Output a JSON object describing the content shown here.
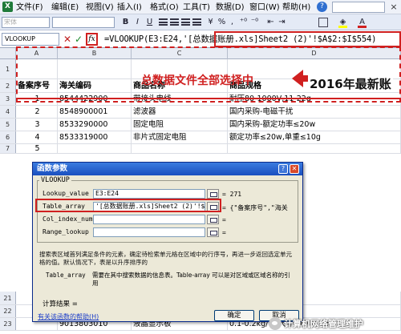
{
  "menubar": {
    "items": [
      "文件(F)",
      "编辑(E)",
      "视图(V)",
      "插入(I)",
      "格式(O)",
      "工具(T)",
      "数据(D)",
      "窗口(W)",
      "帮助(H)"
    ],
    "app_icon": "X"
  },
  "toolbar": {
    "font": "宋体",
    "font_size": "",
    "bold": "B",
    "italic": "I",
    "underline": "U",
    "currency": "¥",
    "percent": "%",
    "comma": ",",
    "fill_color": "#ffff00",
    "font_color": "#d02020"
  },
  "formulabar": {
    "name_box": "VLOOKUP",
    "cancel": "✕",
    "enter": "✓",
    "fx": "fx",
    "formula": "=VLOOKUP(E3:E24,'[总数据账册.xls]Sheet2 (2)'!$A$2:$I$554)"
  },
  "grid": {
    "columns": [
      "A",
      "B",
      "C",
      "D"
    ],
    "rows": [
      {
        "num": "1",
        "cells": [
          "",
          "",
          "",
          ""
        ]
      },
      {
        "num": "2",
        "cells": [
          "备案序号",
          "海关编码",
          "商品名称",
          "商品规格"
        ]
      },
      {
        "num": "3",
        "cells": [
          "1",
          "8544422900",
          "带接头电线",
          "耐压80-1000V,11-22g"
        ]
      },
      {
        "num": "4",
        "cells": [
          "2",
          "8548900001",
          "滤波器",
          "国内采购-电磁干扰"
        ]
      },
      {
        "num": "5",
        "cells": [
          "3",
          "8533290000",
          "固定电阻",
          "国内采购-额定功率≤20w"
        ]
      },
      {
        "num": "6",
        "cells": [
          "4",
          "8533319000",
          "非片式固定电阻",
          "额定功率≤20w,单重≤10g"
        ]
      },
      {
        "num": "7",
        "cells": [
          "5",
          "",
          "",
          ""
        ]
      },
      {
        "num": "21",
        "cells": [
          "",
          "",
          "",
          "变器配件"
        ]
      },
      {
        "num": "22",
        "cells": [
          "",
          "",
          "",
          ""
        ]
      },
      {
        "num": "23",
        "cells": [
          "",
          "9013803010",
          "液晶显示板",
          "0.1-0.2kg/个,尺寸<6X18cm"
        ]
      }
    ]
  },
  "annotations": {
    "select_all_label": "总数据文件全部选择中",
    "year_label": "2016年最新账"
  },
  "dialog": {
    "title": "函数参数",
    "help_btn": "?",
    "close_btn": "✕",
    "group_label": "VLOOKUP",
    "args": [
      {
        "label": "Lookup_value",
        "value": "E3:E24",
        "result": "= 271"
      },
      {
        "label": "Table_array",
        "value": "'[总数据账册.xls]Sheet2 (2)'!$A$",
        "result": "= {\"备案序号\",\"海关"
      },
      {
        "label": "Col_index_num",
        "value": "",
        "result": "="
      },
      {
        "label": "Range_lookup",
        "value": "",
        "result": "="
      }
    ],
    "desc": "搜索表区域首列满足条件的元素，确定待检索单元格在区域中的行序号，再进一步返回选定单元格的值。默认情况下，表是以升序排序的",
    "param_name": "Table_array",
    "param_desc": "需要在其中搜索数据的信息表。Table-array 可以是对区域或区域名称的引用",
    "result_label": "计算结果 =",
    "help_link": "有关该函数的帮助(H)",
    "ok": "确定",
    "cancel": "取消"
  },
  "watermark": "计算机网络管理维护"
}
